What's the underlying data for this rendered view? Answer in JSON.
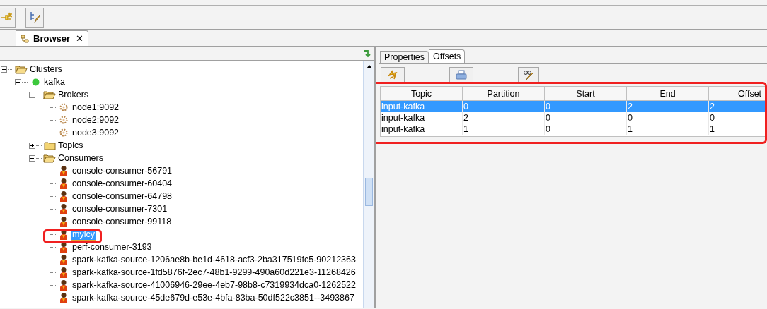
{
  "browser_tab": {
    "label": "Browser",
    "close": "✕"
  },
  "tree": [
    {
      "label": "Clusters",
      "kind": "folder-open",
      "expanded": true,
      "selected": false,
      "children": [
        {
          "label": "kafka",
          "kind": "cluster",
          "expanded": true,
          "selected": false,
          "children": [
            {
              "label": "Brokers",
              "kind": "folder-open",
              "expanded": true,
              "selected": false,
              "children": [
                {
                  "label": "node1:9092",
                  "kind": "broker",
                  "selected": false
                },
                {
                  "label": "node2:9092",
                  "kind": "broker",
                  "selected": false
                },
                {
                  "label": "node3:9092",
                  "kind": "broker",
                  "selected": false
                }
              ]
            },
            {
              "label": "Topics",
              "kind": "folder",
              "expanded": false,
              "selected": false
            },
            {
              "label": "Consumers",
              "kind": "folder-open",
              "expanded": true,
              "selected": false,
              "children": [
                {
                  "label": "console-consumer-56791",
                  "kind": "consumer",
                  "selected": false
                },
                {
                  "label": "console-consumer-60404",
                  "kind": "consumer",
                  "selected": false
                },
                {
                  "label": "console-consumer-64798",
                  "kind": "consumer",
                  "selected": false
                },
                {
                  "label": "console-consumer-7301",
                  "kind": "consumer",
                  "selected": false
                },
                {
                  "label": "console-consumer-99118",
                  "kind": "consumer",
                  "selected": false
                },
                {
                  "label": "mylcy",
                  "kind": "consumer",
                  "selected": true
                },
                {
                  "label": "perf-consumer-3193",
                  "kind": "consumer",
                  "selected": false
                },
                {
                  "label": "spark-kafka-source-1206ae8b-be1d-4618-acf3-2ba317519fc5-90212363",
                  "kind": "consumer",
                  "selected": false
                },
                {
                  "label": "spark-kafka-source-1fd5876f-2ec7-48b1-9299-490a60d221e3-11268426",
                  "kind": "consumer",
                  "selected": false
                },
                {
                  "label": "spark-kafka-source-41006946-29ee-4eb7-98b8-c7319934dca0-1262522",
                  "kind": "consumer",
                  "selected": false
                },
                {
                  "label": "spark-kafka-source-45de679d-e53e-4bfa-83ba-50df522c3851--3493867",
                  "kind": "consumer",
                  "selected": false
                }
              ]
            }
          ]
        }
      ]
    }
  ],
  "detail_tabs": [
    {
      "label": "Properties",
      "selected": false
    },
    {
      "label": "Offsets",
      "selected": true
    }
  ],
  "table": {
    "columns": [
      "Topic",
      "Partition",
      "Start",
      "End",
      "Offset"
    ],
    "rows": [
      {
        "cells": [
          "input-kafka",
          "0",
          "0",
          "2",
          "2"
        ],
        "selected": true
      },
      {
        "cells": [
          "input-kafka",
          "2",
          "0",
          "0",
          "0"
        ],
        "selected": false
      },
      {
        "cells": [
          "input-kafka",
          "1",
          "0",
          "1",
          "1"
        ],
        "selected": false
      }
    ]
  }
}
